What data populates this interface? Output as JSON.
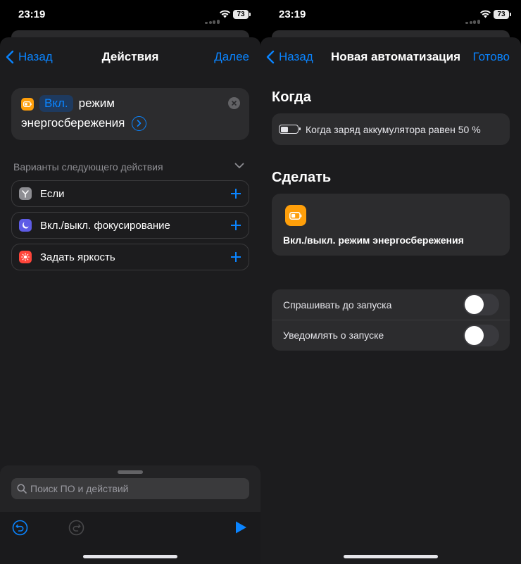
{
  "left": {
    "status": {
      "time": "23:19",
      "battery": "73"
    },
    "nav": {
      "back": "Назад",
      "title": "Действия",
      "action": "Далее"
    },
    "action_card": {
      "token": "Вкл.",
      "line1_rest": "режим",
      "line2": "энергосбережения"
    },
    "suggestions": {
      "header": "Варианты следующего действия",
      "items": [
        {
          "label": "Если",
          "icon": "branch-icon",
          "color": "#8e8e93"
        },
        {
          "label": "Вкл./выкл. фокусирование",
          "icon": "moon-icon",
          "color": "#5e5ce6"
        },
        {
          "label": "Задать яркость",
          "icon": "sun-icon",
          "color": "#ff453a"
        }
      ]
    },
    "search": {
      "placeholder": "Поиск ПО и действий"
    }
  },
  "right": {
    "status": {
      "time": "23:19",
      "battery": "73"
    },
    "nav": {
      "back": "Назад",
      "title": "Новая автоматизация",
      "action": "Готово"
    },
    "when": {
      "title": "Когда",
      "trigger": "Когда заряд аккумулятора равен 50 %"
    },
    "do": {
      "title": "Сделать",
      "action": "Вкл./выкл. режим энергосбережения"
    },
    "options": [
      {
        "label": "Спрашивать до запуска",
        "on": false
      },
      {
        "label": "Уведомлять о запуске",
        "on": false
      }
    ]
  },
  "colors": {
    "accent": "#0a84ff",
    "orange": "#ff9f0a",
    "card": "#2c2c2e",
    "sheet": "#1c1c1e"
  }
}
